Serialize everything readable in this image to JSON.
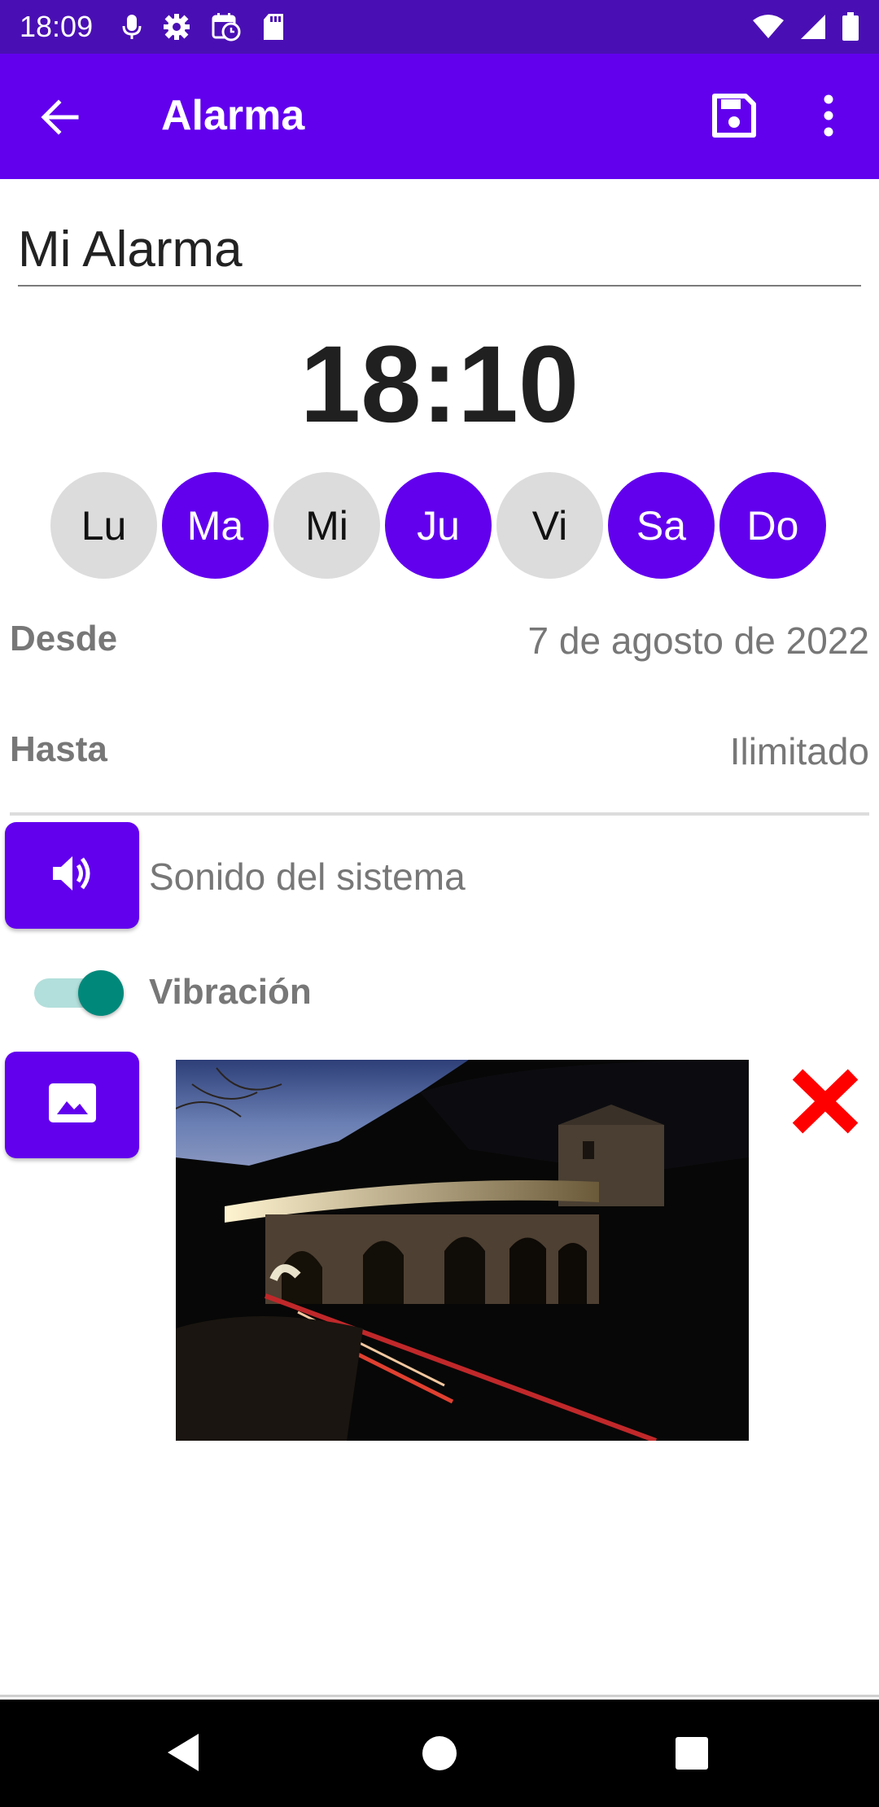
{
  "status_bar": {
    "time": "18:09",
    "icons": [
      "mic-icon",
      "gear-icon",
      "alarm-calendar-icon",
      "sd-card-icon",
      "wifi-icon",
      "signal-icon",
      "battery-icon"
    ]
  },
  "app_bar": {
    "title": "Alarma",
    "back_icon": "arrow-left-icon",
    "save_icon": "save-icon",
    "more_icon": "more-vert-icon"
  },
  "alarm": {
    "name": "Mi Alarma",
    "time": "18:10"
  },
  "days": [
    {
      "label": "Lu",
      "selected": false
    },
    {
      "label": "Ma",
      "selected": true
    },
    {
      "label": "Mi",
      "selected": false
    },
    {
      "label": "Ju",
      "selected": true
    },
    {
      "label": "Vi",
      "selected": false
    },
    {
      "label": "Sa",
      "selected": true
    },
    {
      "label": "Do",
      "selected": true
    }
  ],
  "range": {
    "from_label": "Desde",
    "from_value": "7 de agosto de 2022",
    "until_label": "Hasta",
    "until_value": "Ilimitado"
  },
  "sound": {
    "icon": "volume-icon",
    "label": "Sonido del sistema"
  },
  "vibration": {
    "label": "Vibración",
    "enabled": true
  },
  "image": {
    "icon": "image-icon",
    "delete_icon": "close-icon"
  },
  "colors": {
    "primary": "#6200ee",
    "status_bar": "#4a0fb4",
    "switch_on": "#00897b",
    "delete": "#ff0000"
  }
}
